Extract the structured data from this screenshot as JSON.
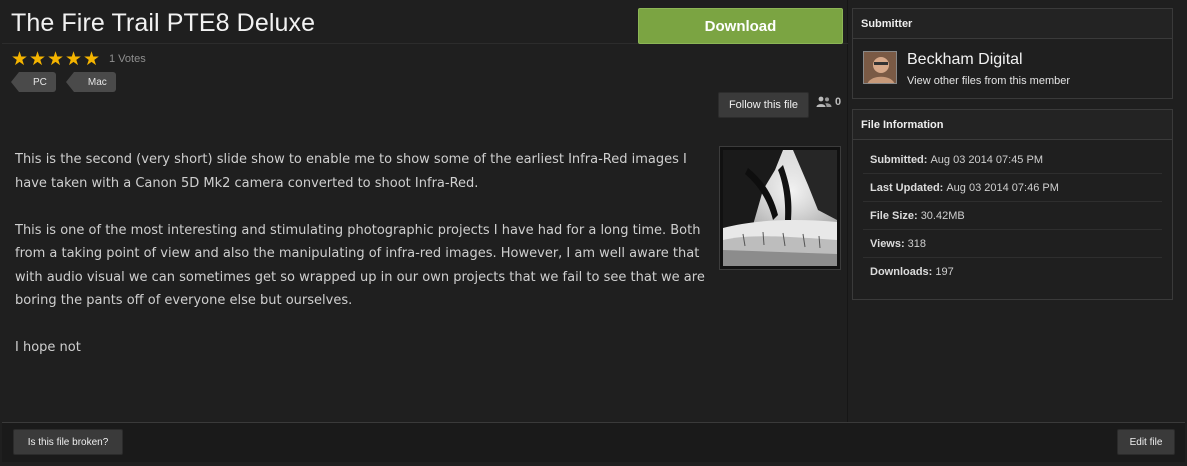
{
  "file": {
    "title": "The Fire Trail PTE8 Deluxe",
    "download_label": "Download",
    "rating": {
      "stars": 5,
      "max": 5,
      "votes_label": "1 Votes"
    },
    "tags": [
      "PC",
      "Mac"
    ],
    "follow_label": "Follow this file",
    "followers_count": "0",
    "description": [
      "This is the second (very short) slide show to enable me to show some of the earliest Infra-Red images I have taken with a Canon 5D Mk2 camera converted to shoot Infra-Red.",
      "This is one of the most interesting and stimulating photographic projects I have had for a long time. Both from a taking point of view and also the manipulating of infra-red images. However, I am well aware that with audio visual we can sometimes get so wrapped up in our own projects that we fail to see that we are boring the pants off of everyone else but ourselves.",
      "I hope not"
    ]
  },
  "submitter": {
    "heading": "Submitter",
    "name": "Beckham Digital",
    "link_label": "View other files from this member"
  },
  "file_info": {
    "heading": "File Information",
    "rows": [
      {
        "label": "Submitted:",
        "value": "Aug 03 2014 07:45 PM"
      },
      {
        "label": "Last Updated:",
        "value": "Aug 03 2014 07:46 PM"
      },
      {
        "label": "File Size:",
        "value": "30.42MB"
      },
      {
        "label": "Views:",
        "value": "318"
      },
      {
        "label": "Downloads:",
        "value": "197"
      }
    ]
  },
  "footer": {
    "broken_label": "Is this file broken?",
    "edit_label": "Edit file"
  },
  "colors": {
    "download_green": "#7ba442",
    "star_gold": "#f4b400",
    "background": "#1f1f1f"
  },
  "icons": {
    "rating": "star-icon",
    "followers": "user-group-icon"
  }
}
